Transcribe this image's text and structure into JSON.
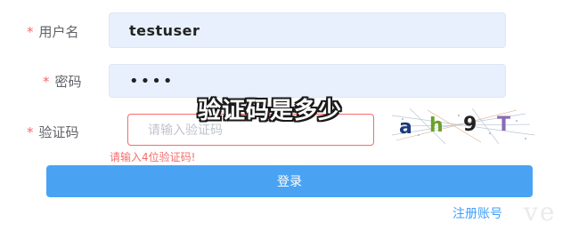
{
  "form": {
    "required_mark": "*",
    "username": {
      "label": "用户名",
      "value": "testuser"
    },
    "password": {
      "label": "密码",
      "value": "••••"
    },
    "captcha": {
      "label": "验证码",
      "placeholder": "请输入验证码",
      "error": "请输入4位验证码!",
      "image_text": "ah9T"
    },
    "login_label": "登录",
    "register_label": "注册账号"
  },
  "overlay_caption": "验证码是多少",
  "watermark": "ve",
  "colors": {
    "required": "#f56c6c",
    "error_border": "#f56c6c",
    "primary_button": "#4aa3f2",
    "link": "#409eff",
    "autofill_bg": "#e8f0fe"
  }
}
